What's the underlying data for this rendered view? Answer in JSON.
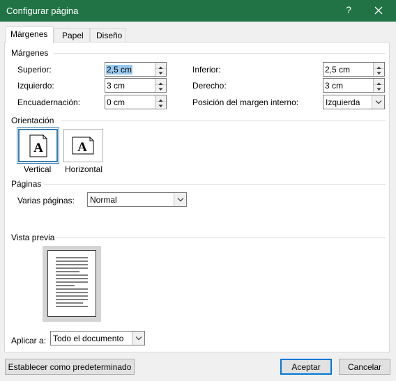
{
  "window": {
    "title": "Configurar página",
    "help": "?"
  },
  "tabs": [
    "Márgenes",
    "Papel",
    "Diseño"
  ],
  "margins": {
    "group": "Márgenes",
    "top_label": "Superior:",
    "top_value": "2,5 cm",
    "bottom_label": "Inferior:",
    "bottom_value": "2,5 cm",
    "left_label": "Izquierdo:",
    "left_value": "3 cm",
    "right_label": "Derecho:",
    "right_value": "3 cm",
    "gutter_label": "Encuadernación:",
    "gutter_value": "0 cm",
    "gutter_pos_label": "Posición del margen interno:",
    "gutter_pos_value": "Izquierda"
  },
  "orientation": {
    "group": "Orientación",
    "portrait": "Vertical",
    "landscape": "Horizontal",
    "icon_letter": "A"
  },
  "pages": {
    "group": "Páginas",
    "multiple_label": "Varias páginas:",
    "multiple_value": "Normal"
  },
  "preview": {
    "group": "Vista previa"
  },
  "apply": {
    "label": "Aplicar a:",
    "value": "Todo el documento"
  },
  "buttons": {
    "default": "Establecer como predeterminado",
    "ok": "Aceptar",
    "cancel": "Cancelar"
  },
  "colors": {
    "titlebar": "#217346",
    "accent": "#0078d7",
    "selection": "#99c9ef"
  }
}
